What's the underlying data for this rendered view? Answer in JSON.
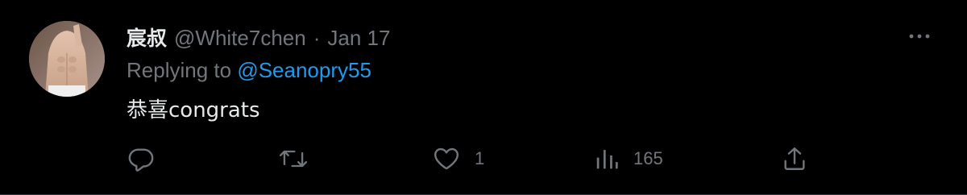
{
  "tweet": {
    "display_name": "宸叔",
    "handle": "@White7chen",
    "separator": "·",
    "date": "Jan 17",
    "replying_prefix": "Replying to",
    "replying_to": "@Seanopry55",
    "text": "恭喜congrats"
  },
  "actions": {
    "reply": {
      "icon": "reply-icon"
    },
    "retweet": {
      "icon": "retweet-icon"
    },
    "like": {
      "icon": "heart-icon",
      "count": "1"
    },
    "views": {
      "icon": "views-icon",
      "count": "165"
    },
    "share": {
      "icon": "share-icon"
    }
  },
  "colors": {
    "background": "#000000",
    "primary_text": "#e7e9ea",
    "secondary_text": "#71767b",
    "link": "#1d9bf0"
  }
}
